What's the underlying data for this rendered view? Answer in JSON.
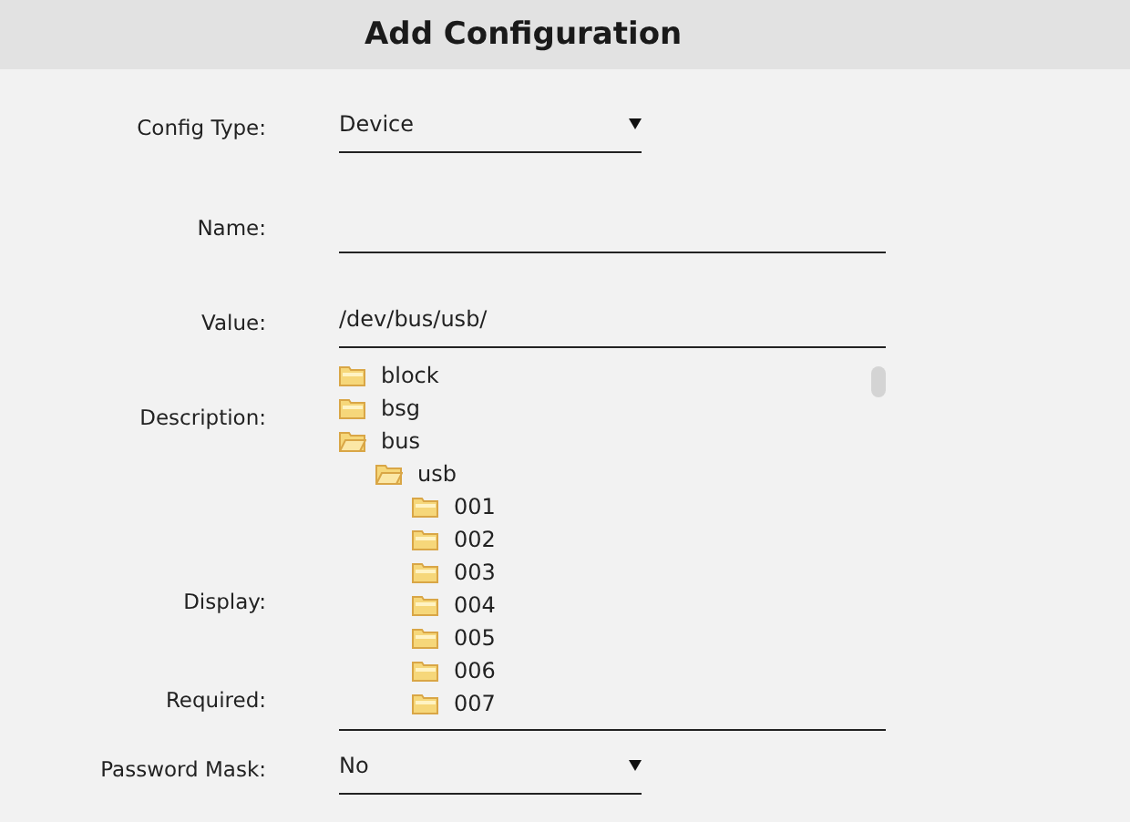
{
  "dialog": {
    "title": "Add Configuration"
  },
  "fields": [
    {
      "label": "Config Type:",
      "kind": "select",
      "value": "Device"
    },
    {
      "label": "Name:",
      "kind": "text"
    },
    {
      "label": "Value:",
      "kind": "text",
      "value": "/dev/bus/usb/",
      "tree": [
        {
          "name": "block",
          "expanded": false
        },
        {
          "name": "bsg",
          "expanded": false
        },
        {
          "name": "bus",
          "expanded": true,
          "children": [
            {
              "name": "usb",
              "expanded": true,
              "children": [
                {
                  "name": "001",
                  "expanded": false
                },
                {
                  "name": "002",
                  "expanded": false
                },
                {
                  "name": "003",
                  "expanded": false
                },
                {
                  "name": "004",
                  "expanded": false
                },
                {
                  "name": "005",
                  "expanded": false
                },
                {
                  "name": "006",
                  "expanded": false
                },
                {
                  "name": "007",
                  "expanded": false
                }
              ]
            }
          ]
        }
      ]
    },
    {
      "label": "Description:",
      "kind": "covered"
    },
    {
      "label": "Display:",
      "kind": "covered"
    },
    {
      "label": "Required:",
      "kind": "covered"
    },
    {
      "label": "Password Mask:",
      "kind": "select",
      "value": "No"
    }
  ]
}
